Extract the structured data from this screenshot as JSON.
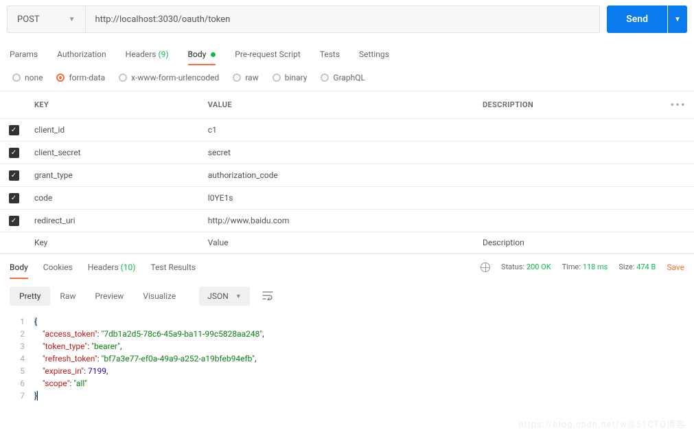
{
  "request": {
    "method": "POST",
    "url": "http://localhost:3030/oauth/token",
    "send_label": "Send"
  },
  "tabs": {
    "params": "Params",
    "authorization": "Authorization",
    "headers": "Headers",
    "headers_count": "(9)",
    "body": "Body",
    "prerequest": "Pre-request Script",
    "tests": "Tests",
    "settings": "Settings"
  },
  "body_types": {
    "none": "none",
    "formdata": "form-data",
    "urlencoded": "x-www-form-urlencoded",
    "raw": "raw",
    "binary": "binary",
    "graphql": "GraphQL"
  },
  "table": {
    "headers": {
      "key": "KEY",
      "value": "VALUE",
      "description": "DESCRIPTION"
    },
    "rows": [
      {
        "key": "client_id",
        "value": "c1"
      },
      {
        "key": "client_secret",
        "value": "secret"
      },
      {
        "key": "grant_type",
        "value": "authorization_code"
      },
      {
        "key": "code",
        "value": "l0YE1s"
      },
      {
        "key": "redirect_uri",
        "value": "http://www.baidu.com"
      }
    ],
    "placeholder": {
      "key": "Key",
      "value": "Value",
      "description": "Description"
    }
  },
  "response": {
    "tabs": {
      "body": "Body",
      "cookies": "Cookies",
      "headers": "Headers",
      "headers_count": "(10)",
      "testresults": "Test Results"
    },
    "status_label": "Status:",
    "status_value": "200 OK",
    "time_label": "Time:",
    "time_value": "118 ms",
    "size_label": "Size:",
    "size_value": "474 B",
    "save": "Save"
  },
  "viewer": {
    "pretty": "Pretty",
    "raw": "Raw",
    "preview": "Preview",
    "visualize": "Visualize",
    "format": "JSON"
  },
  "json_body": {
    "access_token_key": "\"access_token\"",
    "access_token_val": "\"7db1a2d5-78c6-45a9-ba11-99c5828aa248\"",
    "token_type_key": "\"token_type\"",
    "token_type_val": "\"bearer\"",
    "refresh_token_key": "\"refresh_token\"",
    "refresh_token_val": "\"bf7a3e77-ef0a-49a9-a252-a19bfeb94efb\"",
    "expires_in_key": "\"expires_in\"",
    "expires_in_val": "7199",
    "scope_key": "\"scope\"",
    "scope_val": "\"all\""
  },
  "line_numbers": [
    "1",
    "2",
    "3",
    "4",
    "5",
    "6",
    "7"
  ],
  "watermark": "https://blog.csdn.net/w@51CTO博客"
}
